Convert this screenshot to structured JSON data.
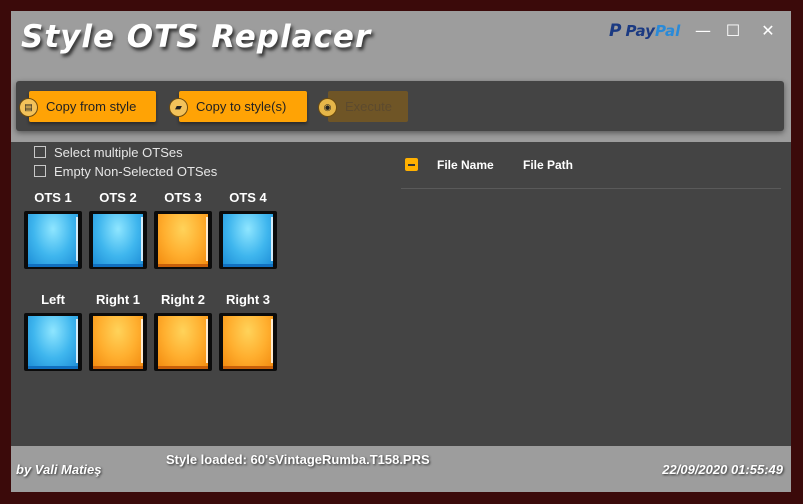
{
  "app": {
    "title": "Style OTS Replacer",
    "paypal_pay": "Pay",
    "paypal_pal": "Pal",
    "window_buttons": {
      "minimize": "—",
      "maximize": "☐",
      "close": "✕"
    }
  },
  "toolbar": {
    "copy_from_label": "Copy from style",
    "copy_to_label": "Copy to style(s)",
    "execute_label": "Execute",
    "accent": "#ffa305"
  },
  "options": {
    "select_multiple": "Select multiple OTSes",
    "empty_non_selected": "Empty Non-Selected OTSes"
  },
  "pads": {
    "ots": [
      {
        "label": "OTS 1",
        "color": "blue"
      },
      {
        "label": "OTS 2",
        "color": "blue"
      },
      {
        "label": "OTS 3",
        "color": "orange"
      },
      {
        "label": "OTS 4",
        "color": "blue"
      }
    ],
    "parts": [
      {
        "label": "Left",
        "color": "blue"
      },
      {
        "label": "Right 1",
        "color": "orange"
      },
      {
        "label": "Right 2",
        "color": "orange"
      },
      {
        "label": "Right 3",
        "color": "orange"
      }
    ]
  },
  "table": {
    "columns": [
      "File Name",
      "File Path"
    ]
  },
  "status": {
    "author": "by Vali Matieş",
    "loaded": "Style loaded: 60'sVintageRumba.T158.PRS",
    "datetime": "22/09/2020 01:55:49"
  }
}
